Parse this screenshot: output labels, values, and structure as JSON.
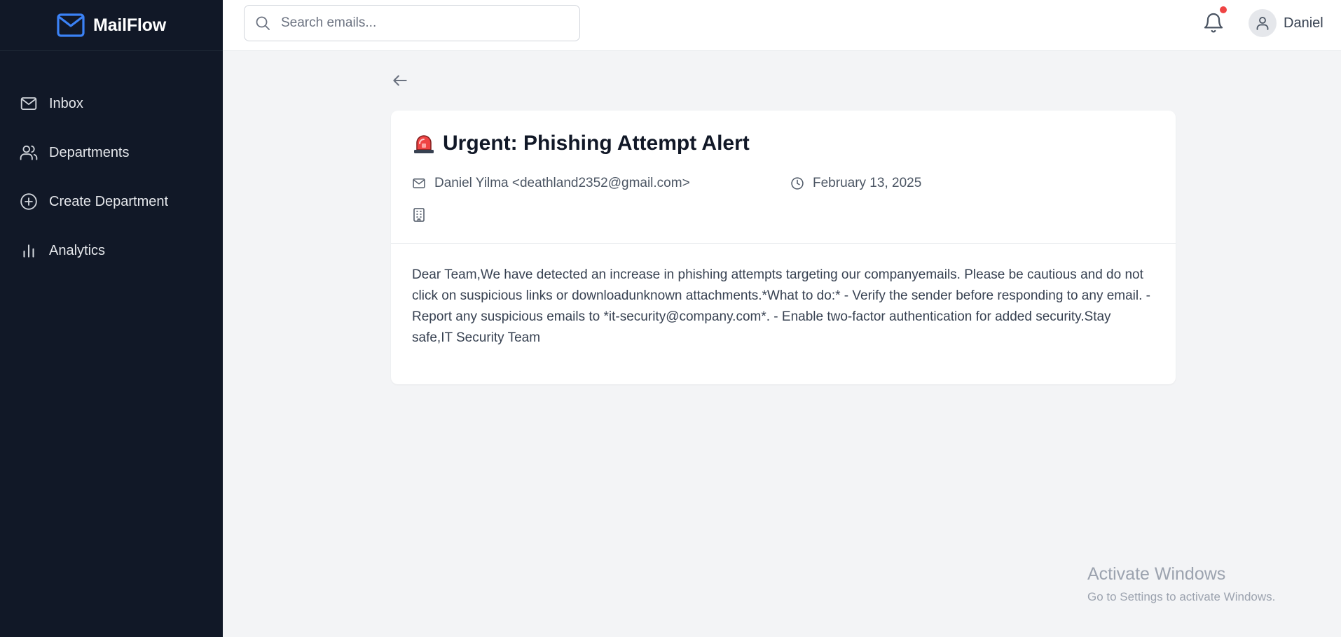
{
  "brand": {
    "name": "MailFlow",
    "color": "#3b82f6"
  },
  "sidebar": {
    "items": [
      {
        "label": "Inbox",
        "icon": "mail-icon"
      },
      {
        "label": "Departments",
        "icon": "users-icon"
      },
      {
        "label": "Create Department",
        "icon": "plus-circle-icon"
      },
      {
        "label": "Analytics",
        "icon": "bar-chart-icon"
      }
    ]
  },
  "header": {
    "search": {
      "placeholder": "Search emails...",
      "value": ""
    },
    "notifications": {
      "has_unread": true,
      "dot_color": "#ef4444"
    },
    "user": {
      "name": "Daniel"
    }
  },
  "email": {
    "subject_icon": "siren-icon",
    "subject": "Urgent: Phishing Attempt Alert",
    "sender": "Daniel Yilma <deathland2352@gmail.com>",
    "date": "February 13, 2025",
    "department": "",
    "body": "Dear Team,We have detected an increase in phishing attempts targeting our companyemails. Please be cautious and do not click on suspicious links or downloadunknown attachments.*What to do:* - Verify the sender before responding to any email. - Report any suspicious emails to *it-security@company.com*. - Enable two-factor authentication for added security.Stay safe,IT Security Team"
  },
  "watermark": {
    "title": "Activate Windows",
    "subtitle": "Go to Settings to activate Windows."
  },
  "colors": {
    "sidebar_bg": "#111827",
    "page_bg": "#f3f4f6",
    "card_bg": "#ffffff",
    "accent": "#3b82f6"
  }
}
